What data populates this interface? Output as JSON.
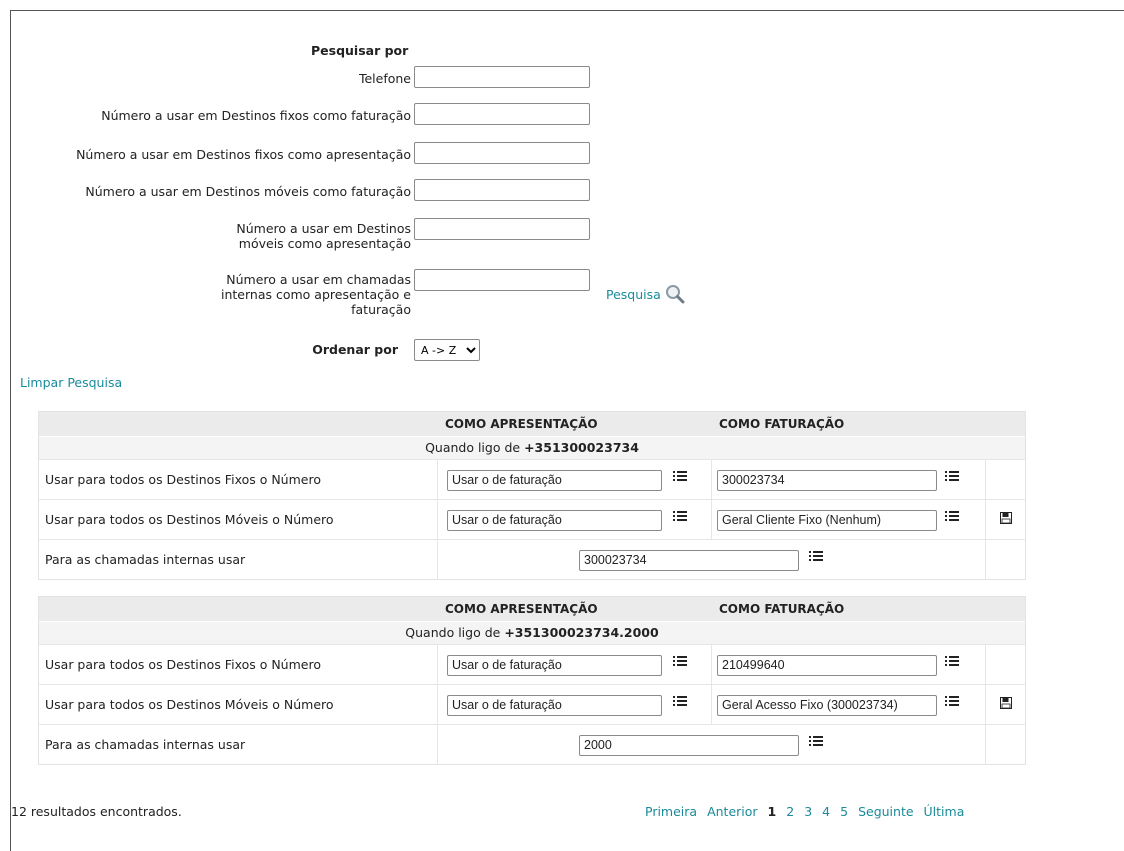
{
  "search": {
    "title": "Pesquisar por",
    "fields": [
      {
        "label": "Telefone",
        "value": ""
      },
      {
        "label": "Número a usar em Destinos fixos como faturação",
        "value": ""
      },
      {
        "label": "Número a usar em Destinos fixos como apresentação",
        "value": ""
      },
      {
        "label": "Número a usar em Destinos móveis como faturação",
        "value": ""
      },
      {
        "label": "Número a usar em Destinos móveis como apresentação",
        "value": ""
      },
      {
        "label": "Número a usar em chamadas internas como apresentação e faturação",
        "value": ""
      }
    ],
    "search_link": "Pesquisa",
    "order_label": "Ordenar por",
    "order_value": "A -> Z",
    "clear_link": "Limpar Pesquisa"
  },
  "blocks": [
    {
      "col_presentation": "COMO APRESENTAÇÃO",
      "col_billing": "COMO FATURAÇÃO",
      "when_prefix": "Quando ligo de",
      "when_number": "+351300023734",
      "rows": [
        {
          "label": "Usar para todos os Destinos Fixos o Número",
          "presentation": "Usar o de faturação",
          "billing": "300023734"
        },
        {
          "label": "Usar para todos os Destinos Móveis o Número",
          "presentation": "Usar o de faturação",
          "billing": "Geral Cliente Fixo (Nenhum)"
        }
      ],
      "internal_label": "Para as chamadas internas usar",
      "internal_value": "300023734"
    },
    {
      "col_presentation": "COMO APRESENTAÇÃO",
      "col_billing": "COMO FATURAÇÃO",
      "when_prefix": "Quando ligo de",
      "when_number": "+351300023734.2000",
      "rows": [
        {
          "label": "Usar para todos os Destinos Fixos o Número",
          "presentation": "Usar o de faturação",
          "billing": "210499640"
        },
        {
          "label": "Usar para todos os Destinos Móveis o Número",
          "presentation": "Usar o de faturação",
          "billing": "Geral Acesso Fixo (300023734)"
        }
      ],
      "internal_label": "Para as chamadas internas usar",
      "internal_value": "2000"
    }
  ],
  "results": "12 resultados encontrados.",
  "pager": {
    "first": "Primeira",
    "prev": "Anterior",
    "pages": [
      "1",
      "2",
      "3",
      "4",
      "5"
    ],
    "next": "Seguinte",
    "last": "Última"
  },
  "colors": {
    "link": "#1a8a9a",
    "header_bg": "#ebebeb"
  }
}
